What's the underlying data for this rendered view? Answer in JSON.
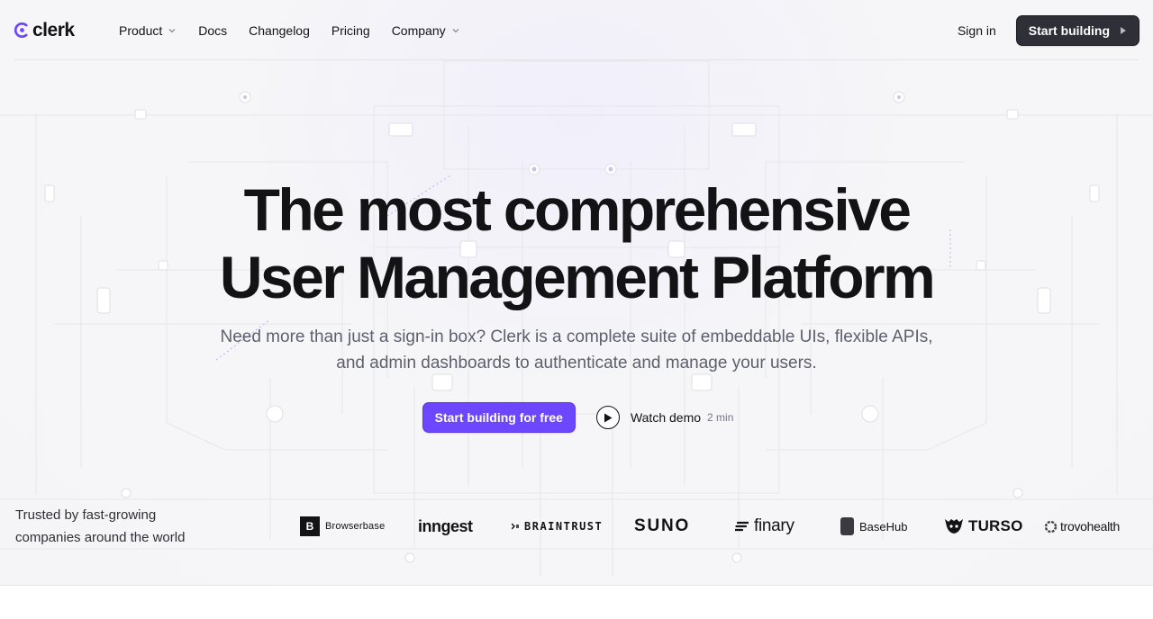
{
  "nav": {
    "logo_text": "clerk",
    "links": [
      {
        "label": "Product",
        "has_dropdown": true
      },
      {
        "label": "Docs",
        "has_dropdown": false
      },
      {
        "label": "Changelog",
        "has_dropdown": false
      },
      {
        "label": "Pricing",
        "has_dropdown": false
      },
      {
        "label": "Company",
        "has_dropdown": true
      }
    ],
    "sign_in": "Sign in",
    "cta": "Start building"
  },
  "hero": {
    "headline_line1": "The most comprehensive",
    "headline_line2": "User Management Platform",
    "subtext": "Need more than just a sign-in box? Clerk is a complete suite of embeddable UIs, flexible APIs, and admin dashboards to authenticate and manage your users.",
    "primary_cta": "Start building for free",
    "watch_demo": "Watch demo",
    "watch_duration": "2 min"
  },
  "trusted": {
    "text": "Trusted by fast-growing companies around the world",
    "logos": {
      "browserbase_mark": "B",
      "browserbase": "Browserbase",
      "inngest": "inngest",
      "braintrust": "BRAINTRUST",
      "suno": "SUNO",
      "finary": "finary",
      "basehub": "BaseHub",
      "turso": "TURSO",
      "trovohealth": "trovohealth"
    }
  },
  "colors": {
    "brand_purple": "#6c47ff",
    "dark_button": "#2f3037",
    "text": "#131316",
    "muted_text": "#5e5f6e"
  },
  "icons": [
    "clerk-logo-icon",
    "chevron-down-icon",
    "play-icon",
    "triangle-right-icon"
  ]
}
